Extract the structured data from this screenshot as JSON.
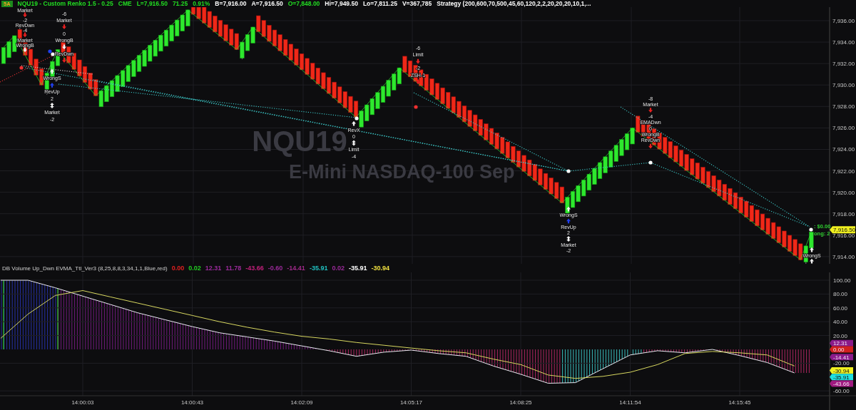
{
  "header": {
    "badge": "5A",
    "items": [
      {
        "text": "NQU19 - Custom Renko 1.5 - 0.25",
        "color": "#22dd22"
      },
      {
        "text": "CME",
        "color": "#22dd22"
      },
      {
        "text": "L=7,916.50",
        "color": "#22dd22"
      },
      {
        "text": "71.25",
        "color": "#22dd22"
      },
      {
        "text": "0.91%",
        "color": "#22dd22"
      },
      {
        "text": "B=7,916.00",
        "color": "#ffffff"
      },
      {
        "text": "A=7,916.50",
        "color": "#ffffff"
      },
      {
        "text": "O=7,848.00",
        "color": "#22dd22"
      },
      {
        "text": "Hi=7,949.50",
        "color": "#ffffff"
      },
      {
        "text": "Lo=7,811.25",
        "color": "#ffffff"
      },
      {
        "text": "V=367,785",
        "color": "#ffffff"
      },
      {
        "text": "Strategy (200,600,70,500,45,60,120,2,2,20,20,20,10,1,...",
        "color": "#ffffff"
      }
    ]
  },
  "price_chart": {
    "watermark": {
      "symbol": "NQU19",
      "description": "E-Mini NASDAQ-100 Sep"
    },
    "chart_data": {
      "type": "line",
      "grid": true,
      "categories": [
        null,
        null,
        null,
        null,
        null,
        null,
        null,
        null,
        null,
        null,
        null,
        null,
        null,
        null,
        null,
        null,
        null,
        null,
        null,
        null,
        null,
        null,
        null,
        null,
        null,
        null,
        null,
        null,
        null,
        null,
        null,
        null,
        null,
        null,
        null,
        null,
        null,
        null,
        null,
        null,
        null,
        null,
        null,
        null,
        null,
        null,
        null,
        null,
        null,
        null,
        null,
        null,
        null,
        null,
        null,
        null,
        null,
        null,
        null,
        null,
        null,
        null,
        null,
        null,
        null,
        null,
        null,
        null,
        null,
        null,
        null,
        null,
        null,
        null,
        null,
        null,
        null,
        null,
        null,
        null,
        null,
        null,
        null,
        null,
        null,
        null,
        null,
        null,
        null,
        null,
        null,
        null,
        null,
        null,
        null,
        null,
        null,
        null,
        null,
        null,
        null,
        null,
        null,
        null,
        null,
        null,
        null,
        null,
        null,
        null,
        null,
        null,
        null,
        null,
        null,
        null,
        null,
        null,
        null,
        null,
        null,
        null,
        null,
        null,
        null,
        null,
        null,
        null,
        null,
        null,
        null,
        null,
        null,
        null,
        null,
        null,
        null,
        null,
        null,
        null,
        null,
        null,
        null,
        null,
        null,
        null,
        null,
        null,
        null,
        null
      ],
      "series": [
        {
          "color": "#2ee82e",
          "values": [
            7933.5,
            7934.05,
            7934.6,
            7933.68,
            7932.76,
            7931.84,
            7930.92,
            7930.0,
            7931.1,
            7932.2,
            7933.3,
            7932.69,
            7932.07,
            7931.46,
            7930.84,
            7930.23,
            7929.61,
            7929.0,
            7929.47,
            7929.94,
            7930.41,
            7930.88,
            7931.35,
            7931.82,
            7932.29,
            7932.76,
            7933.24,
            7933.71,
            7934.18,
            7934.65,
            7935.12,
            7935.59,
            7936.06,
            7936.53,
            7937.0,
            7936.59,
            7936.18,
            7935.77,
            7935.36,
            7934.94,
            7934.53,
            7934.12,
            7933.71,
            7933.3,
            7934.0,
            7934.7,
            7935.4,
            7934.96,
            7934.52,
            7934.07,
            7933.63,
            7933.19,
            7932.75,
            7932.31,
            7931.86,
            7931.42,
            7930.98,
            7930.54,
            7930.09,
            7929.65,
            7929.21,
            7928.77,
            7928.33,
            7927.88,
            7927.44,
            7927.0,
            7927.58,
            7928.15,
            7928.73,
            7929.3,
            7929.88,
            7930.45,
            7931.03,
            7931.6,
            7931.18,
            7930.76,
            7930.34,
            7929.92,
            7929.5,
            7929.08,
            7928.66,
            7928.24,
            7927.82,
            7927.4,
            7926.98,
            7926.56,
            7926.14,
            7925.72,
            7925.3,
            7924.88,
            7924.46,
            7924.04,
            7923.62,
            7923.2,
            7922.78,
            7922.36,
            7921.94,
            7921.52,
            7921.1,
            7920.68,
            7920.26,
            7919.84,
            7919.42,
            7919.0,
            7919.54,
            7920.08,
            7920.62,
            7921.15,
            7921.69,
            7922.23,
            7922.77,
            7923.31,
            7923.85,
            7924.38,
            7924.92,
            7925.46,
            7926.0,
            7925.6,
            7925.21,
            7924.81,
            7924.41,
            7924.02,
            7923.62,
            7923.22,
            7922.83,
            7922.43,
            7922.03,
            7921.63,
            7921.24,
            7920.84,
            7920.44,
            7920.05,
            7919.65,
            7919.25,
            7918.86,
            7918.46,
            7918.06,
            7917.67,
            7917.27,
            7916.87,
            7916.48,
            7916.08,
            7915.68,
            7915.29,
            7914.89,
            7914.49,
            7914.1,
            7913.7,
            7915.0,
            7916.3
          ]
        }
      ],
      "ylim": [
        7913.33,
        7937.26
      ],
      "yticks": [
        {
          "value": 7936,
          "label": "7,936.00"
        },
        {
          "value": 7934,
          "label": "7,934.00"
        },
        {
          "value": 7932,
          "label": "7,932.00"
        },
        {
          "value": 7930,
          "label": "7,930.00"
        },
        {
          "value": 7928,
          "label": "7,928.00"
        },
        {
          "value": 7926,
          "label": "7,926.00"
        },
        {
          "value": 7924,
          "label": "7,924.00"
        },
        {
          "value": 7922,
          "label": "7,922.00"
        },
        {
          "value": 7920,
          "label": "7,920.00"
        },
        {
          "value": 7918,
          "label": "7,918.00"
        },
        {
          "value": 7916,
          "label": "7,916.00"
        },
        {
          "value": 7914,
          "label": "7,914.00"
        }
      ]
    },
    "signals": [
      {
        "items": [
          {
            "kind": "text",
            "text": "Market"
          },
          {
            "kind": "sell-arrow"
          },
          {
            "kind": "text",
            "text": "-2"
          },
          {
            "kind": "text",
            "text": "RevDwn"
          },
          {
            "kind": "text",
            "text": "-4"
          },
          {
            "kind": "sell-arrow"
          },
          {
            "kind": "text",
            "text": "Market"
          },
          {
            "kind": "text",
            "text": "WrongB"
          },
          {
            "kind": "exit-down-arrow"
          }
        ]
      },
      {
        "items": [
          {
            "kind": "text",
            "text": "-6"
          },
          {
            "kind": "text",
            "text": "Market"
          },
          {
            "kind": "sell-arrow"
          },
          {
            "kind": "text",
            "text": "0"
          },
          {
            "kind": "text",
            "text": "WrongB"
          },
          {
            "kind": "exit-down-arrow"
          },
          {
            "kind": "text",
            "text": "RevDwn"
          },
          {
            "kind": "sell-arrow"
          }
        ]
      },
      {
        "items": [
          {
            "kind": "exit-up-arrow"
          },
          {
            "kind": "text",
            "text": "WrongS"
          },
          {
            "kind": "buy-arrow"
          },
          {
            "kind": "text",
            "text": "RevUp"
          },
          {
            "kind": "text",
            "text": "2"
          },
          {
            "kind": "reverse-arrow"
          },
          {
            "kind": "text",
            "text": "Market"
          },
          {
            "kind": "text",
            "text": "-2"
          }
        ]
      },
      {
        "items": [
          {
            "kind": "exit-up-arrow"
          },
          {
            "kind": "text",
            "text": "RevX"
          },
          {
            "kind": "text",
            "text": "0"
          },
          {
            "kind": "reverse-arrow"
          },
          {
            "kind": "text",
            "text": "Limit"
          },
          {
            "kind": "text",
            "text": "-4"
          }
        ]
      },
      {
        "items": [
          {
            "kind": "text",
            "text": "-6"
          },
          {
            "kind": "text",
            "text": "Limit"
          },
          {
            "kind": "sell-arrow"
          },
          {
            "kind": "text",
            "text": "-2"
          },
          {
            "kind": "text",
            "text": "ZSH-1"
          },
          {
            "kind": "sell-arrow"
          }
        ]
      },
      {
        "items": [
          {
            "kind": "text",
            "text": "-8"
          },
          {
            "kind": "text",
            "text": "Market"
          },
          {
            "kind": "sell-arrow"
          },
          {
            "kind": "text",
            "text": "-4"
          },
          {
            "kind": "text",
            "text": "EMADwn"
          },
          {
            "kind": "text",
            "text": "0"
          },
          {
            "kind": "text",
            "text": "WrongB"
          },
          {
            "kind": "text",
            "text": "RevDwn"
          },
          {
            "kind": "sell-arrow"
          }
        ]
      },
      {
        "items": [
          {
            "kind": "exit-up-arrow"
          },
          {
            "kind": "text",
            "text": "WrongS"
          },
          {
            "kind": "buy-arrow"
          },
          {
            "kind": "text",
            "text": "RevUp"
          },
          {
            "kind": "text",
            "text": "2"
          },
          {
            "kind": "reverse-arrow"
          },
          {
            "kind": "text",
            "text": "Market"
          },
          {
            "kind": "text",
            "text": "-2"
          }
        ]
      },
      {
        "items": [
          {
            "kind": "exit-up-arrow"
          },
          {
            "kind": "text",
            "text": "WrongS"
          },
          {
            "kind": "exit-up-arrow"
          }
        ]
      },
      {
        "items": [
          {
            "kind": "pnl-text",
            "text": ": $0.00",
            "color": "#30d030"
          },
          {
            "kind": "pnl-text",
            "text": "ong: 2",
            "color": "#30d030"
          }
        ]
      }
    ],
    "last_price_tag": {
      "text": "7,916.50",
      "color": "#f0f020"
    }
  },
  "indicator": {
    "title": "DB Volume Up_Dwn EVMA_Ttl_Ver3 (8,25,8,8,3,34,1,1,Blue,red)",
    "values": [
      {
        "text": "0.00",
        "color": "#e02020"
      },
      {
        "text": "0.02",
        "color": "#22cc22"
      },
      {
        "text": "12.31",
        "color": "#9a2a9a"
      },
      {
        "text": "11.78",
        "color": "#9a2a9a"
      },
      {
        "text": "-43.66",
        "color": "#c0207a"
      },
      {
        "text": "-0.60",
        "color": "#9a2a9a"
      },
      {
        "text": "-14.41",
        "color": "#a02a8a"
      },
      {
        "text": "-35.91",
        "color": "#20c0c0"
      },
      {
        "text": "0.02",
        "color": "#9a2a9a"
      },
      {
        "text": "-35.91",
        "color": "#ffffff"
      },
      {
        "text": "-30.94",
        "color": "#f0e040"
      }
    ],
    "chart_data": {
      "type": "line",
      "grid": true,
      "categories": [
        null,
        null,
        null,
        "14:00:03",
        null,
        null,
        null,
        "14:00:43",
        null,
        null,
        null,
        "14:02:09",
        null,
        null,
        null,
        "14:05:17",
        null,
        null,
        null,
        "14:08:25",
        null,
        null,
        null,
        "14:11:54",
        null,
        null,
        null,
        "14:15:45",
        null,
        null
      ],
      "series": [
        {
          "color": "#e8e8f0",
          "values": [
            100,
            100,
            89,
            77,
            65,
            53,
            43,
            33,
            24,
            18,
            12,
            5,
            -2,
            -10,
            -4,
            -1,
            -6,
            -10,
            -24,
            -36,
            -49,
            -48,
            -28,
            -8,
            -2,
            -5,
            0,
            -9,
            -19,
            -34
          ]
        },
        {
          "color": "#d8d860",
          "values": [
            16,
            51,
            78,
            85,
            76,
            67,
            58,
            49,
            40,
            32,
            25,
            19,
            15,
            10,
            6,
            2,
            -2,
            -5,
            -14,
            -22,
            -37,
            -42,
            -39,
            -33,
            -22,
            -6,
            -3,
            -5,
            -8,
            -24
          ]
        }
      ],
      "ylim": [
        -67,
        111.3
      ],
      "yticks": [
        {
          "value": 100,
          "label": "100.00"
        },
        {
          "value": 80,
          "label": "80.00"
        },
        {
          "value": 60,
          "label": "60.00"
        },
        {
          "value": 40,
          "label": "40.00"
        },
        {
          "value": 20,
          "label": "20.00"
        },
        {
          "value": -20,
          "label": "-20.00"
        },
        {
          "value": -60,
          "label": "-60.00"
        }
      ]
    },
    "value_tags": [
      {
        "text": "12.31",
        "color": "#8a1a8a"
      },
      {
        "text": "0.00",
        "color": "#d02020"
      },
      {
        "text": "-14.41",
        "color": "#8a1a8a"
      },
      {
        "text": "-30.94",
        "color": "#f0f020"
      },
      {
        "text": "-35.91",
        "color": "#20e0e0"
      },
      {
        "text": "-43.66",
        "color": "#a01a80"
      }
    ]
  }
}
